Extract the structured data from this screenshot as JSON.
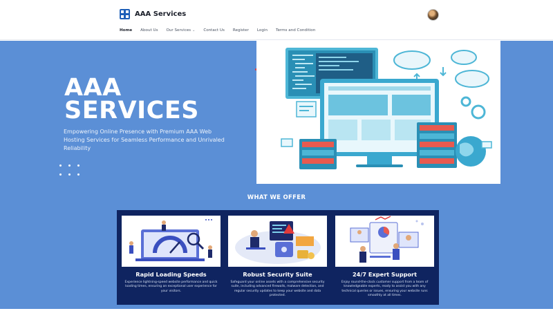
{
  "header": {
    "brand_name": "AAA Services",
    "logo_icon": "grid-logo-icon",
    "avatar_icon": "user-avatar"
  },
  "nav": {
    "items": [
      {
        "label": "Home",
        "active": true
      },
      {
        "label": "About Us"
      },
      {
        "label": "Our Services",
        "has_dropdown": true
      },
      {
        "label": "Contact Us"
      },
      {
        "label": "Register"
      },
      {
        "label": "Login"
      },
      {
        "label": "Terms and Condition"
      }
    ]
  },
  "hero": {
    "title_line1": "AAA",
    "title_line2": "SERVICES",
    "subtitle": "Empowering Online Presence with Premium AAA Web Hosting Services for Seamless Performance and Unrivaled Reliability",
    "illustration": "web-hosting-illustration"
  },
  "offer": {
    "title": "WHAT WE OFFER",
    "cards": [
      {
        "title": "Rapid Loading Speeds",
        "description": "Experience lightning-speed website performance and quick loading times, ensuring an exceptional user experience for your visitors.",
        "illustration": "speedometer-illustration"
      },
      {
        "title": "Robust Security Suite",
        "description": "Safeguard your online assets with a comprehensive security suite, including advanced firewalls, malware detection, and regular security updates to keep your website and data protected.",
        "illustration": "security-illustration"
      },
      {
        "title": "24/7 Expert Support",
        "description": "Enjoy round-the-clock customer support from a team of knowledgeable experts, ready to assist you with any technical queries or issues, ensuring your website runs smoothly at all times.",
        "illustration": "support-team-illustration"
      }
    ]
  },
  "colors": {
    "hero_bg": "#5b8fd6",
    "cards_bg": "#0f2460",
    "brand_blue": "#1e5fb8"
  }
}
